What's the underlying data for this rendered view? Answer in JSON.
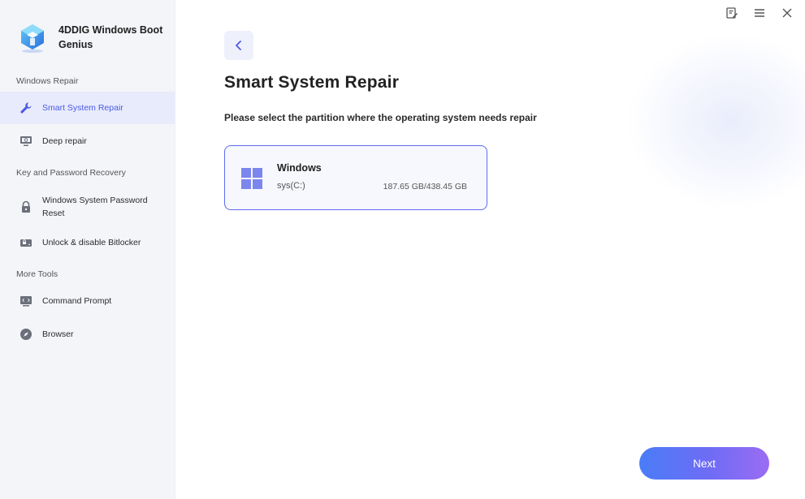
{
  "app": {
    "name": "4DDIG Windows Boot Genius"
  },
  "sidebar": {
    "sections": [
      {
        "label": "Windows Repair",
        "items": [
          {
            "label": "Smart System Repair",
            "icon": "wrench-icon",
            "active": true
          },
          {
            "label": "Deep repair",
            "icon": "monitor-repair-icon",
            "active": false
          }
        ]
      },
      {
        "label": "Key and Password Recovery",
        "items": [
          {
            "label": "Windows System Password Reset",
            "icon": "lock-icon",
            "active": false
          },
          {
            "label": "Unlock & disable Bitlocker",
            "icon": "drive-lock-icon",
            "active": false
          }
        ]
      },
      {
        "label": "More Tools",
        "items": [
          {
            "label": "Command Prompt",
            "icon": "terminal-icon",
            "active": false
          },
          {
            "label": "Browser",
            "icon": "compass-icon",
            "active": false
          }
        ]
      }
    ]
  },
  "window_controls": [
    "feedback-icon",
    "menu-icon",
    "close-icon"
  ],
  "main": {
    "title": "Smart System Repair",
    "subtitle": "Please select the partition where the operating system needs repair",
    "partition": {
      "name": "Windows",
      "drive": "sys(C:)",
      "size": "187.65 GB/438.45 GB",
      "icon": "windows-logo-icon",
      "selected": true
    },
    "next_label": "Next"
  },
  "colors": {
    "accent": "#5b6cf0",
    "active_bg": "#e8ebfb",
    "sidebar_bg": "#f4f5f9",
    "button_gradient_start": "#4a7cf7",
    "button_gradient_end": "#9b6cf3"
  }
}
